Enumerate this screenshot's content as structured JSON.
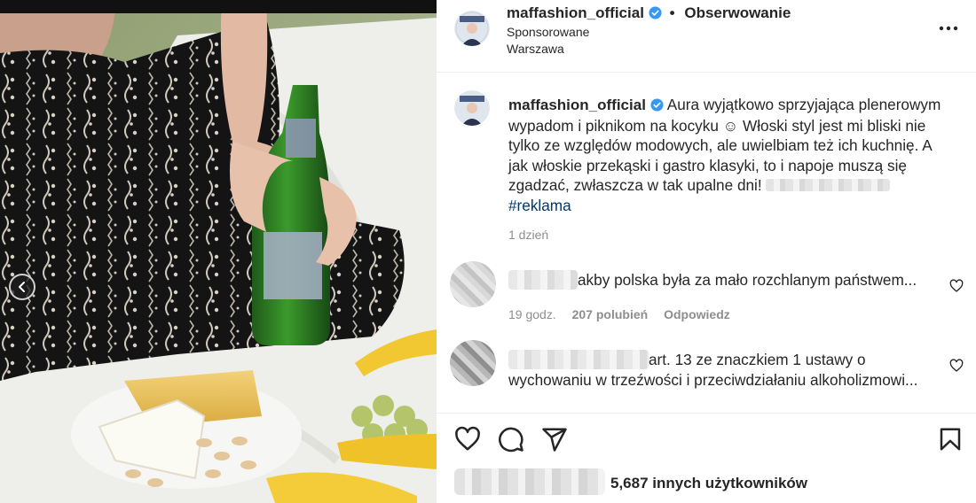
{
  "post": {
    "username": "maffashion_official",
    "dot": "•",
    "follow_label": "Obserwowanie",
    "sponsored_label": "Sponsorowane",
    "location": "Warszawa",
    "caption": "Aura wyjątkowo sprzyjająca plenerowym wypadom i piknikom na kocyku ☺ Włoski styl jest mi bliski nie tylko ze względów modowych, ale uwielbiam też ich kuchnię. A jak włoskie przekąski i gastro klasyki, to i napoje muszą się zgadzać, zwłaszcza w tak upalne dni!",
    "hashtag": "#reklama",
    "time_ago": "1 dzień"
  },
  "comments": [
    {
      "text": "akby polska była za mało rozchlanym państwem...",
      "time": "19 godz.",
      "likes": "207 polubień",
      "reply_label": "Odpowiedz"
    },
    {
      "text": "art. 13 ze znaczkiem 1 ustawy o wychowaniu w trzeźwości i przeciwdziałaniu alkoholizmowi..."
    }
  ],
  "likes_summary": "5,687 innych użytkowników",
  "icons": {
    "verified": "verified-badge-icon",
    "more": "more-options-icon",
    "like": "heart-icon",
    "comment": "comment-icon",
    "share": "share-icon",
    "save": "bookmark-icon",
    "carousel_prev": "chevron-left-icon"
  },
  "colors": {
    "verified_blue": "#3897f0",
    "link": "#00376b",
    "secondary_text": "#8e8e8e"
  }
}
